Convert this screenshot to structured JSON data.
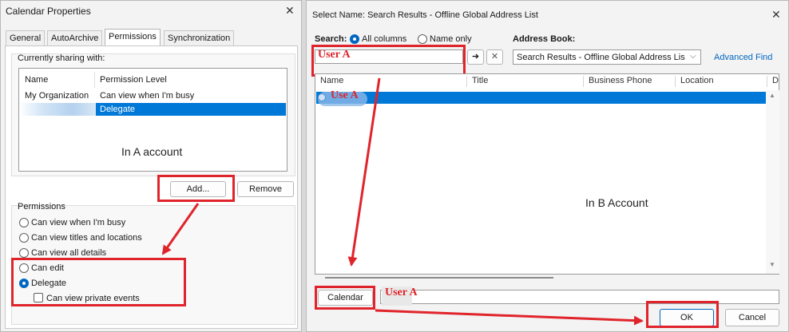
{
  "left_dialog": {
    "title": "Calendar Properties",
    "tabs": [
      "General",
      "AutoArchive",
      "Permissions",
      "Synchronization"
    ],
    "sharing_label": "Currently sharing with:",
    "columns": [
      "Name",
      "Permission Level"
    ],
    "rows": [
      {
        "name": "My Organization",
        "level": "Can view when I'm busy"
      },
      {
        "name": "",
        "level": "Delegate"
      }
    ],
    "annotation": "In A account",
    "add_label": "Add...",
    "remove_label": "Remove",
    "permissions_label": "Permissions",
    "options": [
      "Can view when I'm busy",
      "Can view titles and locations",
      "Can view all details",
      "Can edit",
      "Delegate"
    ],
    "selected_option": "Delegate",
    "checkbox_label": "Can view private events"
  },
  "right_dialog": {
    "title": "Select Name: Search Results - Offline Global Address List",
    "search_label": "Search:",
    "all_columns_label": "All columns",
    "name_only_label": "Name only",
    "address_book_label": "Address Book:",
    "search_value": "User A",
    "address_book_value": "Search Results - Offline Global Address Lis",
    "advanced_find_label": "Advanced Find",
    "columns": [
      "Name",
      "Title",
      "Business Phone",
      "Location",
      "D"
    ],
    "result_name": "Use A",
    "annotation": "In B Account",
    "calendar_button": "Calendar",
    "calendar_value": "User A",
    "ok_label": "OK",
    "cancel_label": "Cancel"
  },
  "colors": {
    "accent": "#0067c0",
    "selection": "#0078d7",
    "annotation_red": "#e0242b"
  }
}
